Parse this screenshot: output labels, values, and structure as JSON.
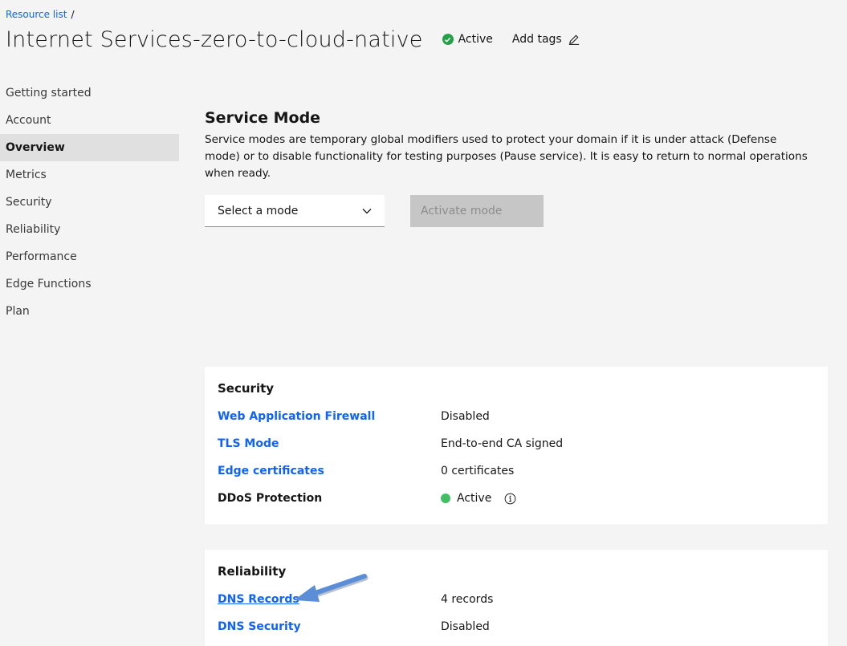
{
  "breadcrumb": {
    "link": "Resource list",
    "separator": "/"
  },
  "header": {
    "title": "Internet Services-zero-to-cloud-native",
    "status": "Active",
    "add_tags": "Add tags"
  },
  "sidebar": {
    "items": [
      {
        "label": "Getting started"
      },
      {
        "label": "Account"
      },
      {
        "label": "Overview",
        "active": true
      },
      {
        "label": "Metrics"
      },
      {
        "label": "Security"
      },
      {
        "label": "Reliability"
      },
      {
        "label": "Performance"
      },
      {
        "label": "Edge Functions"
      },
      {
        "label": "Plan"
      }
    ]
  },
  "service_mode": {
    "title": "Service Mode",
    "description": "Service modes are temporary global modifiers used to protect your domain if it is under attack (Defense mode) or to disable functionality for testing purposes (Pause service). It is easy to return to normal operations when ready.",
    "select_placeholder": "Select a mode",
    "activate_button": "Activate mode"
  },
  "security_card": {
    "title": "Security",
    "rows": [
      {
        "label": "Web Application Firewall",
        "value": "Disabled"
      },
      {
        "label": "TLS Mode",
        "value": "End-to-end CA signed"
      },
      {
        "label": "Edge certificates",
        "value": "0 certificates"
      },
      {
        "label": "DDoS Protection",
        "value": "Active"
      }
    ]
  },
  "reliability_card": {
    "title": "Reliability",
    "rows": [
      {
        "label": "DNS Records",
        "value": "4 records"
      },
      {
        "label": "DNS Security",
        "value": "Disabled"
      }
    ]
  },
  "colors": {
    "link": "#0f62fe",
    "status_green": "#24a148",
    "active_dot": "#42be65",
    "annotation_arrow": "#5b8ed6"
  },
  "icons": [
    "check-circle-icon",
    "edit-icon",
    "chevron-down-icon",
    "info-icon",
    "annotation-arrow"
  ]
}
